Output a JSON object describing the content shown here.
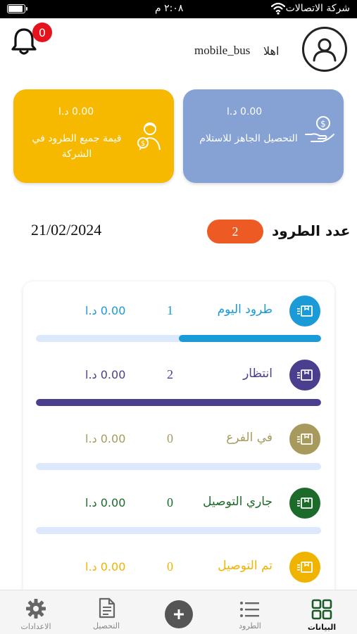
{
  "status_bar": {
    "carrier": "شركة الاتصالات",
    "time": "٢:٠٨ م",
    "battery_level": 0.9
  },
  "header": {
    "notification_count": "0",
    "username": "mobile_bus",
    "greeting": "اهلا"
  },
  "cards": {
    "company_value": {
      "amount": "0.00 د.ا",
      "title": "قيمة جميع الطرود في الشركة"
    },
    "ready_collection": {
      "amount": "0.00 د.ا",
      "title": "التحصيل الجاهز للاستلام"
    }
  },
  "summary": {
    "date": "21/02/2024",
    "parcel_count": "2",
    "parcel_count_label": "عدد الطرود"
  },
  "status_rows": [
    {
      "label": "طرود اليوم",
      "count": "1",
      "amount": "0.00 د.ا",
      "color": "#1a9ad6",
      "progress": 0.5,
      "icon": "box-icon"
    },
    {
      "label": "انتظار",
      "count": "2",
      "amount": "0.00 د.ا",
      "color": "#4a3f8f",
      "progress": 1.0,
      "icon": "box-icon"
    },
    {
      "label": "في الفرع",
      "count": "0",
      "amount": "0.00 د.ا",
      "color": "#a89a5c",
      "progress": 0,
      "icon": "box-icon"
    },
    {
      "label": "جاري التوصيل",
      "count": "0",
      "amount": "0.00 د.ا",
      "color": "#1d6b2a",
      "progress": 0,
      "icon": "box-icon"
    },
    {
      "label": "تم التوصيل",
      "count": "0",
      "amount": "0.00 د.ا",
      "color": "#f0b400",
      "progress": 0,
      "icon": "box-icon"
    }
  ],
  "bottom_nav": {
    "data": "البيانات",
    "parcels": "الطرود",
    "collection": "التحصيل",
    "settings": "الاعدادات"
  }
}
